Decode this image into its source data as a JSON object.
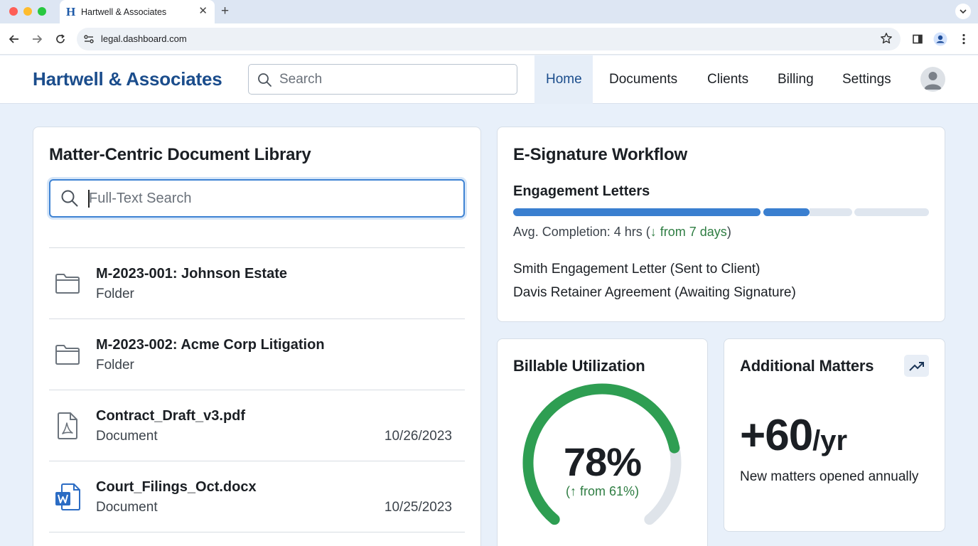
{
  "browser": {
    "tab_title": "Hartwell & Associates",
    "favicon_letter": "H",
    "url": "legal.dashboard.com"
  },
  "app": {
    "brand": "Hartwell & Associates",
    "search_placeholder": "Search",
    "nav": [
      {
        "label": "Home",
        "active": true
      },
      {
        "label": "Documents",
        "active": false
      },
      {
        "label": "Clients",
        "active": false
      },
      {
        "label": "Billing",
        "active": false
      },
      {
        "label": "Settings",
        "active": false
      }
    ]
  },
  "library": {
    "title": "Matter-Centric Document Library",
    "search_placeholder": "Full-Text Search",
    "items": [
      {
        "name": "M-2023-001: Johnson Estate",
        "type": "Folder",
        "date": "",
        "icon": "folder-icon"
      },
      {
        "name": "M-2023-002: Acme Corp Litigation",
        "type": "Folder",
        "date": "",
        "icon": "folder-icon"
      },
      {
        "name": "Contract_Draft_v3.pdf",
        "type": "Document",
        "date": "10/26/2023",
        "icon": "pdf-icon"
      },
      {
        "name": "Court_Filings_Oct.docx",
        "type": "Document",
        "date": "10/25/2023",
        "icon": "word-icon"
      }
    ]
  },
  "esign": {
    "title": "E-Signature Workflow",
    "subtitle": "Engagement Letters",
    "progress_completed_fraction": 0.71,
    "avg_label": "Avg. Completion: 4 hrs (",
    "avg_delta": "↓ from 7 days",
    "avg_close": ")",
    "items": [
      "Smith Engagement Letter (Sent to Client)",
      "Davis Retainer Agreement (Awaiting Signature)"
    ]
  },
  "utilization": {
    "title": "Billable Utilization",
    "value_percent": 78,
    "value_label": "78%",
    "delta": "(↑ from 61%)"
  },
  "matters": {
    "title": "Additional Matters",
    "value": "+60",
    "unit": "/yr",
    "description": "New matters opened annually"
  },
  "colors": {
    "brand": "#1b4d8c",
    "accent": "#3f83d3",
    "success": "#2e9e52",
    "progress_fill": "#3a7fd0",
    "progress_track": "#dfe6ef"
  }
}
